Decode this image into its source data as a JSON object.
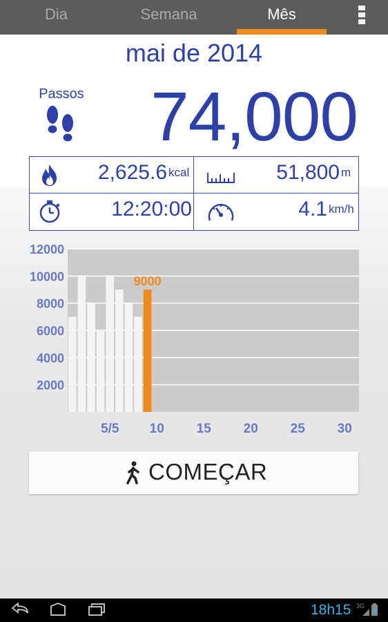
{
  "tabs": [
    {
      "label": "Dia",
      "active": false
    },
    {
      "label": "Semana",
      "active": false
    },
    {
      "label": "Mês",
      "active": true
    }
  ],
  "header": {
    "period": "mai de 2014"
  },
  "steps": {
    "label": "Passos",
    "value": "74,000",
    "icon": "footprints-icon"
  },
  "stats": {
    "calories": {
      "value": "2,625.6",
      "unit": "kcal",
      "icon": "flame-icon"
    },
    "distance": {
      "value": "51,800",
      "unit": "m",
      "icon": "ruler-icon"
    },
    "duration": {
      "value": "12:20:00",
      "icon": "stopwatch-icon"
    },
    "speed": {
      "value": "4.1",
      "unit": "km/h",
      "icon": "speedometer-icon"
    }
  },
  "chart_data": {
    "type": "bar",
    "ylim": [
      0,
      12000
    ],
    "yticks": [
      2000,
      4000,
      6000,
      8000,
      10000,
      12000
    ],
    "x_days": 31,
    "xticks": [
      {
        "day": 5,
        "label": "5/5"
      },
      {
        "day": 10,
        "label": "10"
      },
      {
        "day": 15,
        "label": "15"
      },
      {
        "day": 20,
        "label": "20"
      },
      {
        "day": 25,
        "label": "25"
      },
      {
        "day": 30,
        "label": "30"
      }
    ],
    "days": [
      1,
      2,
      3,
      4,
      5,
      6,
      7,
      8,
      9
    ],
    "values": [
      7000,
      10000,
      8000,
      6000,
      10000,
      9000,
      8000,
      7000,
      9000
    ],
    "highlight_day": 9,
    "highlight_label": "9000",
    "colors": {
      "bar": "#f4f4f4",
      "highlight": "#f08a1c",
      "plot_bg": "#cbcbcb",
      "ticks": "#6b78c8"
    }
  },
  "start_button": {
    "label": "COMEÇAR",
    "icon": "walking-person-icon"
  },
  "status": {
    "time": "18h15",
    "network": "3G"
  },
  "navbar": [
    "back-icon",
    "home-icon",
    "recent-apps-icon"
  ]
}
